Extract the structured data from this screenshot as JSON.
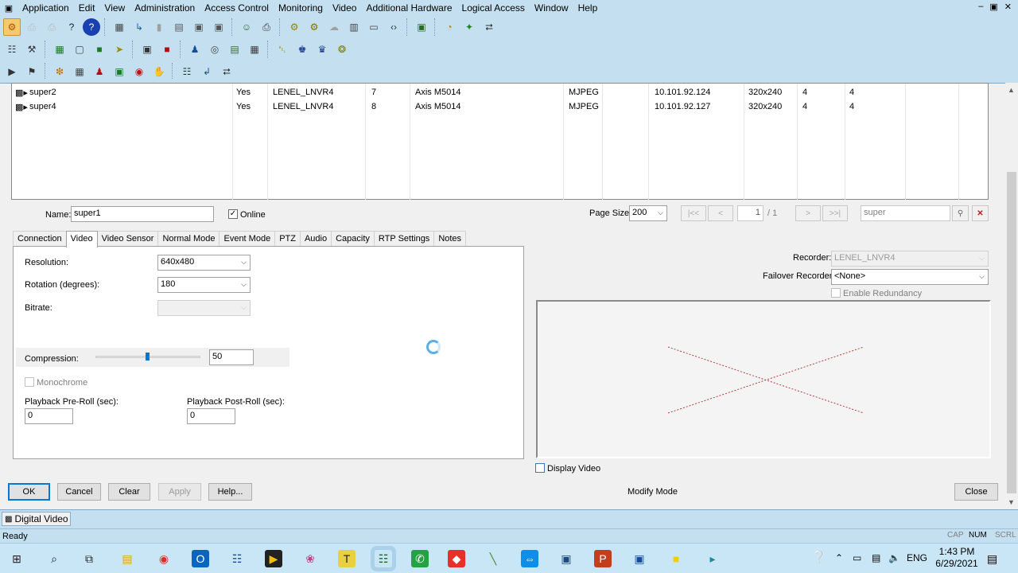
{
  "menu": {
    "items": [
      "Application",
      "Edit",
      "View",
      "Administration",
      "Access Control",
      "Monitoring",
      "Video",
      "Additional Hardware",
      "Logical Access",
      "Window",
      "Help"
    ],
    "window_buttons": [
      "–",
      "▣",
      "✕"
    ]
  },
  "toolbar1": [
    {
      "name": "alarm-monitor-icon",
      "glyph": "⚙",
      "color": "#b05000",
      "highlight": true
    },
    {
      "name": "print-preview-icon",
      "glyph": "⎙",
      "color": "#b8b8b8"
    },
    {
      "name": "print-icon",
      "glyph": "⎙",
      "color": "#b8b8b8"
    },
    {
      "name": "help-icon",
      "glyph": "?",
      "color": "#222"
    },
    {
      "name": "help-topics-icon",
      "glyph": "?",
      "color": "#fff",
      "bg": "#1a3fb0"
    },
    {
      "name": "sep"
    },
    {
      "name": "cardholders-icon",
      "glyph": "▦",
      "color": "#444"
    },
    {
      "name": "access-levels-icon",
      "glyph": "↳",
      "color": "#1a5fb0"
    },
    {
      "name": "badge-icon",
      "glyph": "▮",
      "color": "#a0a0a0"
    },
    {
      "name": "reports-icon",
      "glyph": "▤",
      "color": "#555"
    },
    {
      "name": "forms-icon",
      "glyph": "▣",
      "color": "#555"
    },
    {
      "name": "dialog-icon",
      "glyph": "▣",
      "color": "#555"
    },
    {
      "name": "sep"
    },
    {
      "name": "users-icon",
      "glyph": "☺",
      "color": "#2a6a2a"
    },
    {
      "name": "printer-setup-icon",
      "glyph": "⎙",
      "color": "#333"
    },
    {
      "name": "sep"
    },
    {
      "name": "system-options-icon",
      "glyph": "⚙",
      "color": "#9a7a00"
    },
    {
      "name": "workstations-icon",
      "glyph": "⚙",
      "color": "#7a6a00"
    },
    {
      "name": "cloud-icon",
      "glyph": "☁",
      "color": "#a0a0a0"
    },
    {
      "name": "archive-icon",
      "glyph": "▥",
      "color": "#444"
    },
    {
      "name": "window-icon",
      "glyph": "▭",
      "color": "#444"
    },
    {
      "name": "code-icon",
      "glyph": "‹›",
      "color": "#333"
    },
    {
      "name": "sep"
    },
    {
      "name": "import-icon",
      "glyph": "▣",
      "color": "#2a6a2a"
    },
    {
      "name": "sep"
    },
    {
      "name": "clock-icon",
      "glyph": "◔",
      "color": "#b08a00"
    },
    {
      "name": "network-icon",
      "glyph": "✦",
      "color": "#1a8a1a"
    },
    {
      "name": "topology-icon",
      "glyph": "⮂",
      "color": "#333"
    }
  ],
  "toolbar2": [
    {
      "name": "system-tree-icon",
      "glyph": "☷",
      "color": "#333"
    },
    {
      "name": "tools-icon",
      "glyph": "⚒",
      "color": "#333"
    },
    {
      "name": "sep"
    },
    {
      "name": "panels-icon",
      "glyph": "▦",
      "color": "#1a7a1a"
    },
    {
      "name": "readers-icon",
      "glyph": "▢",
      "color": "#444"
    },
    {
      "name": "hardware-icon",
      "glyph": "■",
      "color": "#1a7a2a"
    },
    {
      "name": "alarm-inputs-icon",
      "glyph": "➤",
      "color": "#9a8a00"
    },
    {
      "name": "sep"
    },
    {
      "name": "intrusion-icon",
      "glyph": "▣",
      "color": "#333"
    },
    {
      "name": "alarm-panel-icon",
      "glyph": "■",
      "color": "#b01010"
    },
    {
      "name": "sep"
    },
    {
      "name": "guard-tour-icon",
      "glyph": "♟",
      "color": "#1a4a9a"
    },
    {
      "name": "globe-icon",
      "glyph": "◎",
      "color": "#444"
    },
    {
      "name": "map-icon",
      "glyph": "▤",
      "color": "#3a6a3a"
    },
    {
      "name": "area-icon",
      "glyph": "▦",
      "color": "#3a3a3a"
    },
    {
      "name": "sep"
    },
    {
      "name": "bell-icon",
      "glyph": "␇",
      "color": "#b08a00"
    },
    {
      "name": "guard-icon",
      "glyph": "♚",
      "color": "#1a3a8a"
    },
    {
      "name": "officer-icon",
      "glyph": "♛",
      "color": "#1a3a8a"
    },
    {
      "name": "signal-icon",
      "glyph": "❂",
      "color": "#7a7a00"
    }
  ],
  "toolbar3": [
    {
      "name": "digital-video-icon",
      "glyph": "▶",
      "color": "#333"
    },
    {
      "name": "camera-tree-icon",
      "glyph": "⚑",
      "color": "#333"
    },
    {
      "name": "sep"
    },
    {
      "name": "alarms-icon",
      "glyph": "❇",
      "color": "#c07000"
    },
    {
      "name": "matrix-icon",
      "glyph": "▦",
      "color": "#444"
    },
    {
      "name": "person-icon",
      "glyph": "♟",
      "color": "#b01010"
    },
    {
      "name": "monitor-icon",
      "glyph": "▣",
      "color": "#1a7a2a"
    },
    {
      "name": "target-icon",
      "glyph": "◉",
      "color": "#c01010"
    },
    {
      "name": "hand-icon",
      "glyph": "✋",
      "color": "#b08a00"
    },
    {
      "name": "sep"
    },
    {
      "name": "ptz-icon",
      "glyph": "☷",
      "color": "#333"
    },
    {
      "name": "export-icon",
      "glyph": "↲",
      "color": "#1a4a9a"
    },
    {
      "name": "link-icon",
      "glyph": "⮂",
      "color": "#333"
    }
  ],
  "grid": {
    "rows": [
      {
        "name": "super2",
        "online": "Yes",
        "recorder": "LENEL_LNVR4",
        "channel": "7",
        "model": "Axis M5014",
        "format": "MJPEG",
        "ip": "10.101.92.124",
        "resolution": "320x240",
        "c1": "4",
        "c2": "4"
      },
      {
        "name": "super4",
        "online": "Yes",
        "recorder": "LENEL_LNVR4",
        "channel": "8",
        "model": "Axis M5014",
        "format": "MJPEG",
        "ip": "10.101.92.127",
        "resolution": "320x240",
        "c1": "4",
        "c2": "4"
      }
    ]
  },
  "form": {
    "name_label": "Name:",
    "name_value": "super1",
    "online_label": "Online",
    "online_checked": true,
    "page_size_label": "Page Size:",
    "page_size_value": "200",
    "page_first": "|<<",
    "page_prev": "<",
    "page_current": "1",
    "page_total": "/ 1",
    "page_next": ">",
    "page_last": ">>|",
    "search_value": "super"
  },
  "tabs": [
    "Connection",
    "Video",
    "Video Sensor",
    "Normal Mode",
    "Event Mode",
    "PTZ",
    "Audio",
    "Capacity",
    "RTP Settings",
    "Notes"
  ],
  "selected_tab": "Video",
  "video_tab": {
    "resolution_label": "Resolution:",
    "resolution_value": "640x480",
    "rotation_label": "Rotation (degrees):",
    "rotation_value": "180",
    "bitrate_label": "Bitrate:",
    "bitrate_value": "",
    "compression_label": "Compression:",
    "compression_value": "50",
    "compression_slider_fraction": 0.5,
    "monochrome_label": "Monochrome",
    "preroll_label": "Playback Pre-Roll (sec):",
    "preroll_value": "0",
    "postroll_label": "Playback Post-Roll (sec):",
    "postroll_value": "0"
  },
  "right_panel": {
    "recorder_label": "Recorder:",
    "recorder_value": "LENEL_LNVR4",
    "failover_label": "Failover Recorder:",
    "failover_value": "<None>",
    "redundancy_label": "Enable Redundancy",
    "display_video_label": "Display Video"
  },
  "buttons": {
    "ok": "OK",
    "cancel": "Cancel",
    "clear": "Clear",
    "apply": "Apply",
    "help": "Help...",
    "close": "Close"
  },
  "mode_text": "Modify Mode",
  "window_tab": "Digital Video",
  "status": {
    "text": "Ready",
    "caps": "CAP",
    "num": "NUM",
    "scrl": "SCRL"
  },
  "taskbar": {
    "apps": [
      {
        "name": "start-icon",
        "glyph": "⊞",
        "color": "#222"
      },
      {
        "name": "search-icon",
        "glyph": "⌕",
        "color": "#222"
      },
      {
        "name": "task-view-icon",
        "glyph": "⧉",
        "color": "#222"
      },
      {
        "name": "file-explorer-icon",
        "glyph": "▤",
        "color": "#d9a520"
      },
      {
        "name": "chrome-icon",
        "glyph": "◉",
        "color": "#d93025"
      },
      {
        "name": "outlook-icon",
        "glyph": "O",
        "color": "#fff",
        "bg": "#0a64c0"
      },
      {
        "name": "network-app-icon",
        "glyph": "☷",
        "color": "#1a4a9a"
      },
      {
        "name": "media-player-icon",
        "glyph": "▶",
        "color": "#f0c000",
        "bg": "#222"
      },
      {
        "name": "paint-icon",
        "glyph": "❀",
        "color": "#c04080"
      },
      {
        "name": "text-editor-icon",
        "glyph": "T",
        "color": "#222",
        "bg": "#e8d040"
      },
      {
        "name": "onguard-icon",
        "glyph": "☷",
        "color": "#1a6a1a"
      },
      {
        "name": "whatsapp-icon",
        "glyph": "✆",
        "color": "#fff",
        "bg": "#25a244"
      },
      {
        "name": "anydesk-icon",
        "glyph": "◆",
        "color": "#fff",
        "bg": "#e8302a"
      },
      {
        "name": "tool-icon",
        "glyph": "╲",
        "color": "#4a8a2a"
      },
      {
        "name": "teamviewer-icon",
        "glyph": "⇔",
        "color": "#fff",
        "bg": "#0e8ee9"
      },
      {
        "name": "remote-desktop-icon",
        "glyph": "▣",
        "color": "#1a4a7a"
      },
      {
        "name": "powerpoint-icon",
        "glyph": "P",
        "color": "#fff",
        "bg": "#c43e1c"
      },
      {
        "name": "computer-icon",
        "glyph": "▣",
        "color": "#1a4a9a"
      },
      {
        "name": "sticky-notes-icon",
        "glyph": "■",
        "color": "#f0d000"
      },
      {
        "name": "arrow-app-icon",
        "glyph": "▸",
        "color": "#1a8aa0"
      }
    ],
    "lang": "ENG",
    "time": "1:43 PM",
    "date": "6/29/2021"
  }
}
